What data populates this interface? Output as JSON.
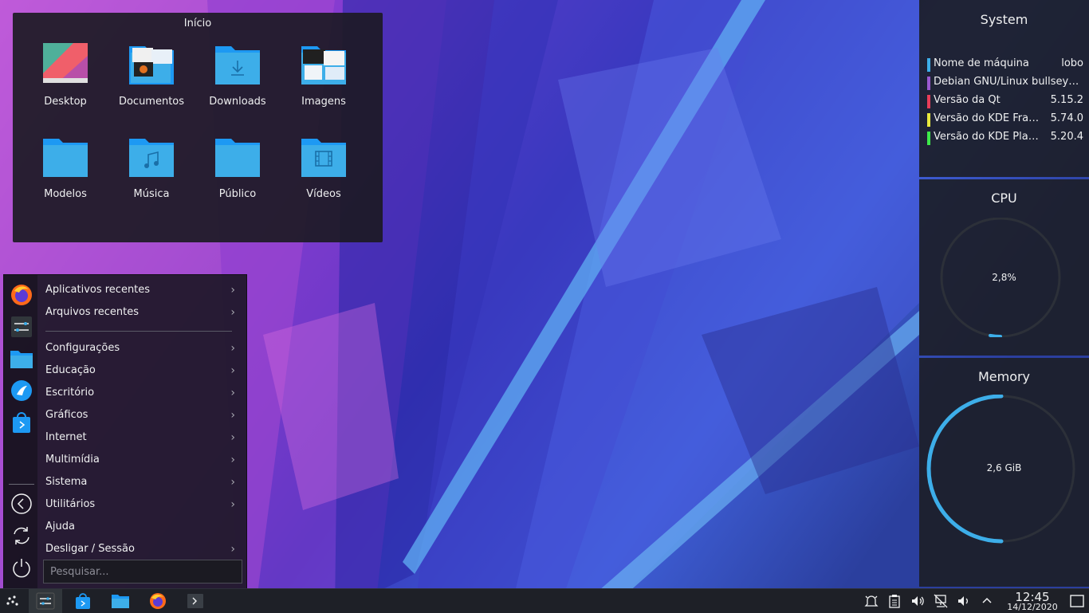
{
  "folder_view": {
    "title": "Início",
    "items": [
      {
        "label": "Desktop",
        "icon": "desktop-folder-icon"
      },
      {
        "label": "Documentos",
        "icon": "documents-folder-icon"
      },
      {
        "label": "Downloads",
        "icon": "downloads-folder-icon"
      },
      {
        "label": "Imagens",
        "icon": "pictures-folder-icon"
      },
      {
        "label": "Modelos",
        "icon": "templates-folder-icon"
      },
      {
        "label": "Música",
        "icon": "music-folder-icon"
      },
      {
        "label": "Público",
        "icon": "public-folder-icon"
      },
      {
        "label": "Vídeos",
        "icon": "videos-folder-icon"
      }
    ]
  },
  "menu": {
    "items": [
      {
        "label": "Aplicativos recentes",
        "submenu": true
      },
      {
        "label": "Arquivos recentes",
        "submenu": true
      },
      {
        "label": "Configurações",
        "submenu": true
      },
      {
        "label": "Educação",
        "submenu": true
      },
      {
        "label": "Escritório",
        "submenu": true
      },
      {
        "label": "Gráficos",
        "submenu": true
      },
      {
        "label": "Internet",
        "submenu": true
      },
      {
        "label": "Multimídia",
        "submenu": true
      },
      {
        "label": "Sistema",
        "submenu": true
      },
      {
        "label": "Utilitários",
        "submenu": true
      },
      {
        "label": "Ajuda",
        "submenu": false
      },
      {
        "label": "Desligar / Sessão",
        "submenu": true
      }
    ],
    "arrow": "›",
    "search_placeholder": "Pesquisar...",
    "favorites": [
      "firefox-icon",
      "system-settings-icon",
      "file-manager-icon",
      "discover-icon",
      "software-store-icon"
    ],
    "session_buttons": [
      "logout-icon",
      "restart-icon",
      "shutdown-icon"
    ]
  },
  "system_widget": {
    "title": "System",
    "rows": [
      {
        "key": "Nome de máquina",
        "value": "lobo",
        "color": "#3daee9"
      },
      {
        "key": "Debian GNU/Linux bullseye...",
        "value": "",
        "color": "#9b59d0"
      },
      {
        "key": "Versão da Qt",
        "value": "5.15.2",
        "color": "#e93d58"
      },
      {
        "key": "Versão do KDE Frameworks",
        "value": "5.74.0",
        "color": "#e9e93d"
      },
      {
        "key": "Versão do KDE Plasma",
        "value": "5.20.4",
        "color": "#3de94a"
      }
    ]
  },
  "cpu_widget": {
    "title": "CPU",
    "value": "2,8%",
    "fraction": 0.028,
    "color": "#3daee9"
  },
  "memory_widget": {
    "title": "Memory",
    "value": "2,6 GiB",
    "fraction": 0.5,
    "color": "#3daee9"
  },
  "taskbar": {
    "launcher": "application-launcher-icon",
    "tasks": [
      "system-settings-icon",
      "software-store-icon",
      "file-manager-icon",
      "firefox-icon",
      "terminal-icon"
    ],
    "tray": [
      "notifications-icon",
      "clipboard-icon",
      "volume-icon",
      "network-icon",
      "audio-icon",
      "tray-expand-icon"
    ],
    "clock_time": "12:45",
    "clock_date": "14/12/2020",
    "show_desktop": "show-desktop-icon"
  }
}
